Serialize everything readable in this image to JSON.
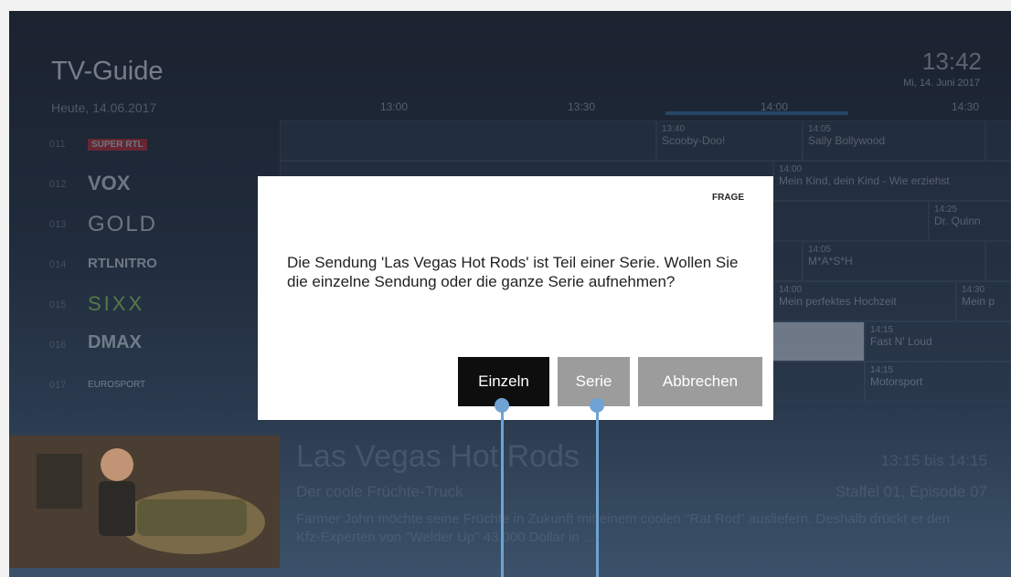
{
  "header": {
    "title": "TV-Guide",
    "date": "Heute, 14.06.2017",
    "clock": "13:42",
    "clock_date": "Mi, 14. Juni 2017"
  },
  "timeline": {
    "ticks": [
      "13:00",
      "13:30",
      "14:00",
      "14:30"
    ]
  },
  "channels": [
    {
      "num": "011",
      "logo": "SUPER RTL"
    },
    {
      "num": "012",
      "logo": "VOX"
    },
    {
      "num": "013",
      "logo": "GOLD"
    },
    {
      "num": "014",
      "logo": "RTLNITRO"
    },
    {
      "num": "015",
      "logo": "SIXX"
    },
    {
      "num": "016",
      "logo": "DMAX"
    },
    {
      "num": "017",
      "logo": "EUROSPORT"
    }
  ],
  "grid_cells": [
    {
      "time": "13:40",
      "title": "Scooby-Doo!"
    },
    {
      "time": "14:05",
      "title": "Sally Bollywood"
    },
    {
      "time": "14:00",
      "title": "Mein Kind, dein Kind - Wie erziehst"
    },
    {
      "time": "14:25",
      "title": "Dr. Quinn"
    },
    {
      "time": "14:05",
      "title": "M*A*S*H"
    },
    {
      "time": "14:00",
      "title": "Mein perfektes Hochzeit"
    },
    {
      "time": "14:30",
      "title": "Mein p"
    },
    {
      "time": "14:15",
      "title": "Fast N' Loud"
    },
    {
      "time": "14:15",
      "title": "Motorsport"
    }
  ],
  "dialog": {
    "label": "FRAGE",
    "message": "Die Sendung 'Las Vegas Hot Rods' ist Teil einer Serie. Wollen Sie die einzelne Sendung oder die ganze Serie aufnehmen?",
    "buttons": {
      "einzeln": "Einzeln",
      "serie": "Serie",
      "abbrechen": "Abbrechen"
    }
  },
  "detail": {
    "title": "Las Vegas Hot Rods",
    "time": "13:15 bis 14:15",
    "subtitle": "Der coole Früchte-Truck",
    "episode": "Staffel 01, Episode 07",
    "description": "Farmer John möchte seine Früchte in Zukunft mit einem coolen \"Rat Rod\" ausliefern. Deshalb drückt er den Kfz-Experten von \"Welder Up\" 43.000 Dollar in ..."
  },
  "colors": {
    "accent": "#6ea3d3",
    "primary_button": "#0e0e0e",
    "secondary_button": "#9c9c9c"
  }
}
